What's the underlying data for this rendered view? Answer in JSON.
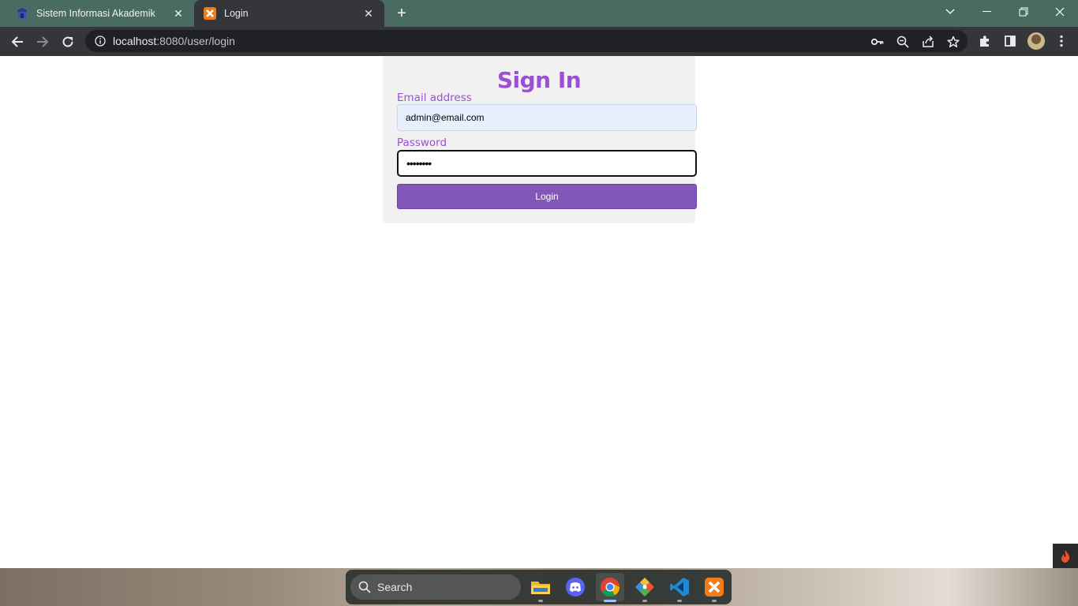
{
  "browser": {
    "tabs": [
      {
        "title": "Sistem Informasi Akademik",
        "icon": "graduation-icon",
        "active": false
      },
      {
        "title": "Login",
        "icon": "xampp-icon",
        "active": true
      }
    ],
    "new_tab_label": "+",
    "url_host": "localhost",
    "url_rest": ":8080/user/login",
    "toolbar_icons": [
      "key-icon",
      "zoom-icon",
      "share-icon",
      "star-icon",
      "extensions-icon",
      "side-panel-icon",
      "profile-avatar",
      "menu-icon"
    ]
  },
  "login": {
    "title": "Sign In",
    "email_label": "Email address",
    "email_value": "admin@email.com",
    "password_label": "Password",
    "password_value": "••••••••",
    "button_label": "Login"
  },
  "taskbar": {
    "search_label": "Search",
    "apps": [
      "file-explorer-icon",
      "discord-icon",
      "chrome-icon",
      "git-icon",
      "vscode-icon",
      "xampp-icon"
    ]
  },
  "colors": {
    "accent": "#9b4fd2",
    "button": "#8257b9",
    "tab_strip": "#4a6b62",
    "toolbar": "#35363a"
  }
}
